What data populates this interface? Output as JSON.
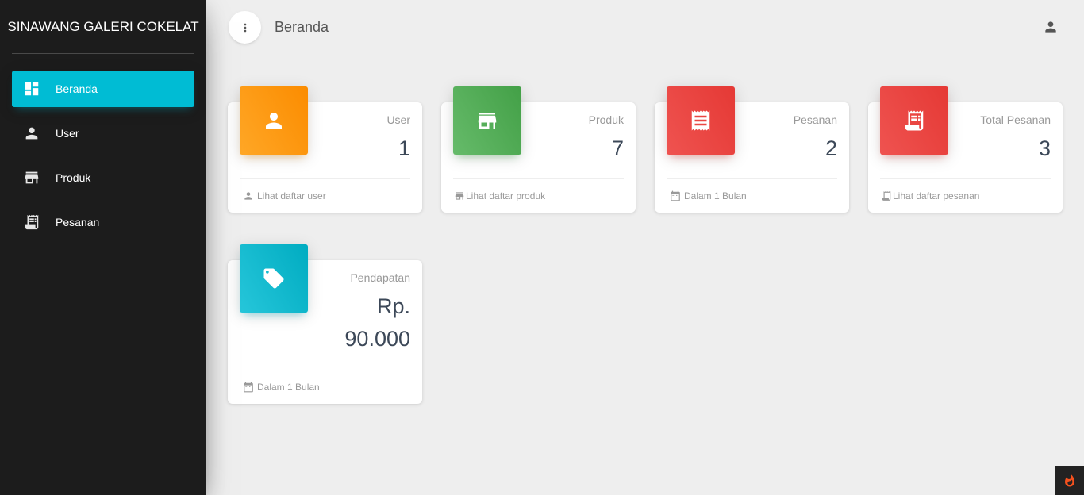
{
  "brand": "SINAWANG GALERI COKELAT",
  "sidebar": {
    "items": [
      {
        "label": "Beranda",
        "icon": "dashboard-icon",
        "active": true
      },
      {
        "label": "User",
        "icon": "person-icon"
      },
      {
        "label": "Produk",
        "icon": "store-icon"
      },
      {
        "label": "Pesanan",
        "icon": "receipt-icon"
      }
    ]
  },
  "topbar": {
    "title": "Beranda",
    "menu_icon": "more-vert-icon",
    "user_icon": "person-icon"
  },
  "cards": [
    {
      "category": "User",
      "value": "1",
      "footer": "Lihat daftar user",
      "color": "#fb8c00",
      "icon": "person-icon",
      "footer_icon": "person-icon"
    },
    {
      "category": "Produk",
      "value": "7",
      "footer": "Lihat daftar produk",
      "color": "#43a047",
      "icon": "store-icon",
      "footer_icon": "store-icon"
    },
    {
      "category": "Pesanan",
      "value": "2",
      "footer": "Dalam 1 Bulan",
      "color": "#e53935",
      "icon": "receipt-list-icon",
      "footer_icon": "calendar-icon"
    },
    {
      "category": "Total Pesanan",
      "value": "3",
      "footer": "Lihat daftar pesanan",
      "color": "#e53935",
      "icon": "receipt-icon",
      "footer_icon": "receipt-icon"
    },
    {
      "category": "Pendapatan",
      "value_line1": "Rp.",
      "value_line2": "90.000",
      "footer": "Dalam 1 Bulan",
      "color": "#00acc1",
      "icon": "tag-icon",
      "footer_icon": "calendar-icon"
    }
  ],
  "colors": {
    "sidebar_bg": "#1c1c1c",
    "active_nav": "#00bcd4",
    "page_bg": "#eeeeee"
  }
}
